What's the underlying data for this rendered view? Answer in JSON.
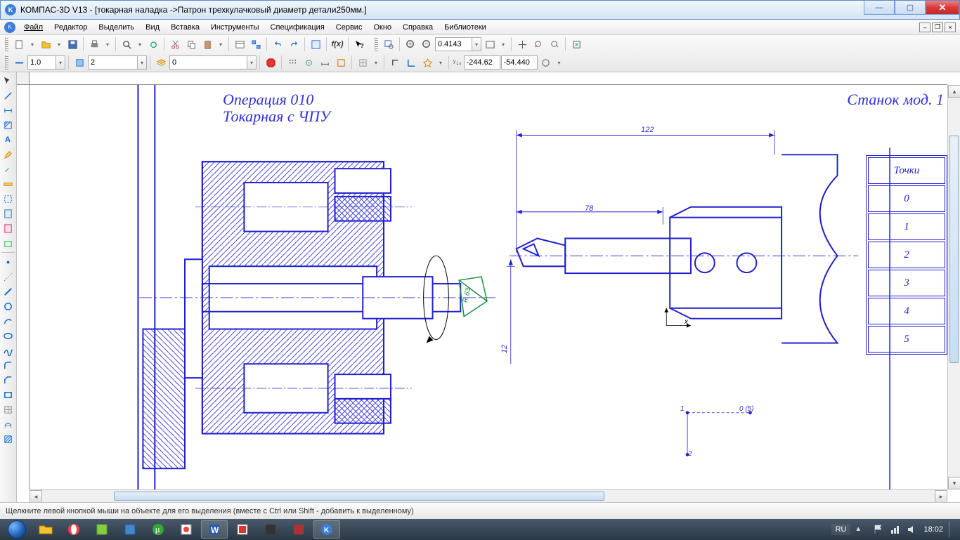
{
  "window": {
    "title": "КОМПАС-3D V13 - [токарная наладка ->Патрон трехкулачковый диаметр детали250мм.]"
  },
  "menu": {
    "items": [
      "Файл",
      "Редактор",
      "Выделить",
      "Вид",
      "Вставка",
      "Инструменты",
      "Спецификация",
      "Сервис",
      "Окно",
      "Справка",
      "Библиотеки"
    ]
  },
  "toolbar2": {
    "zoom_value": "0.4143"
  },
  "toolbar3": {
    "style1": "1.0",
    "style2": "2",
    "layer": "0",
    "coord_x": "-244.62",
    "coord_y": "-54.440"
  },
  "drawing": {
    "op_line1": "Операция 010",
    "op_line2": "Токарная с ЧПУ",
    "right_title": "Станок мод. 1",
    "dim_122": "122",
    "dim_78": "78",
    "dim_12": "12",
    "dim_r": "R 63",
    "anno_1": "1",
    "anno_2": "2",
    "anno_05": "0 (5)",
    "axis_x": "x",
    "table_header": "Точки",
    "table_rows": [
      "0",
      "1",
      "2",
      "3",
      "4",
      "5"
    ]
  },
  "status": {
    "hint": "Щелкните левой кнопкой мыши на объекте для его выделения (вместе с Ctrl или Shift - добавить к выделенному)"
  },
  "taskbar": {
    "lang": "RU",
    "time": "18:02"
  }
}
